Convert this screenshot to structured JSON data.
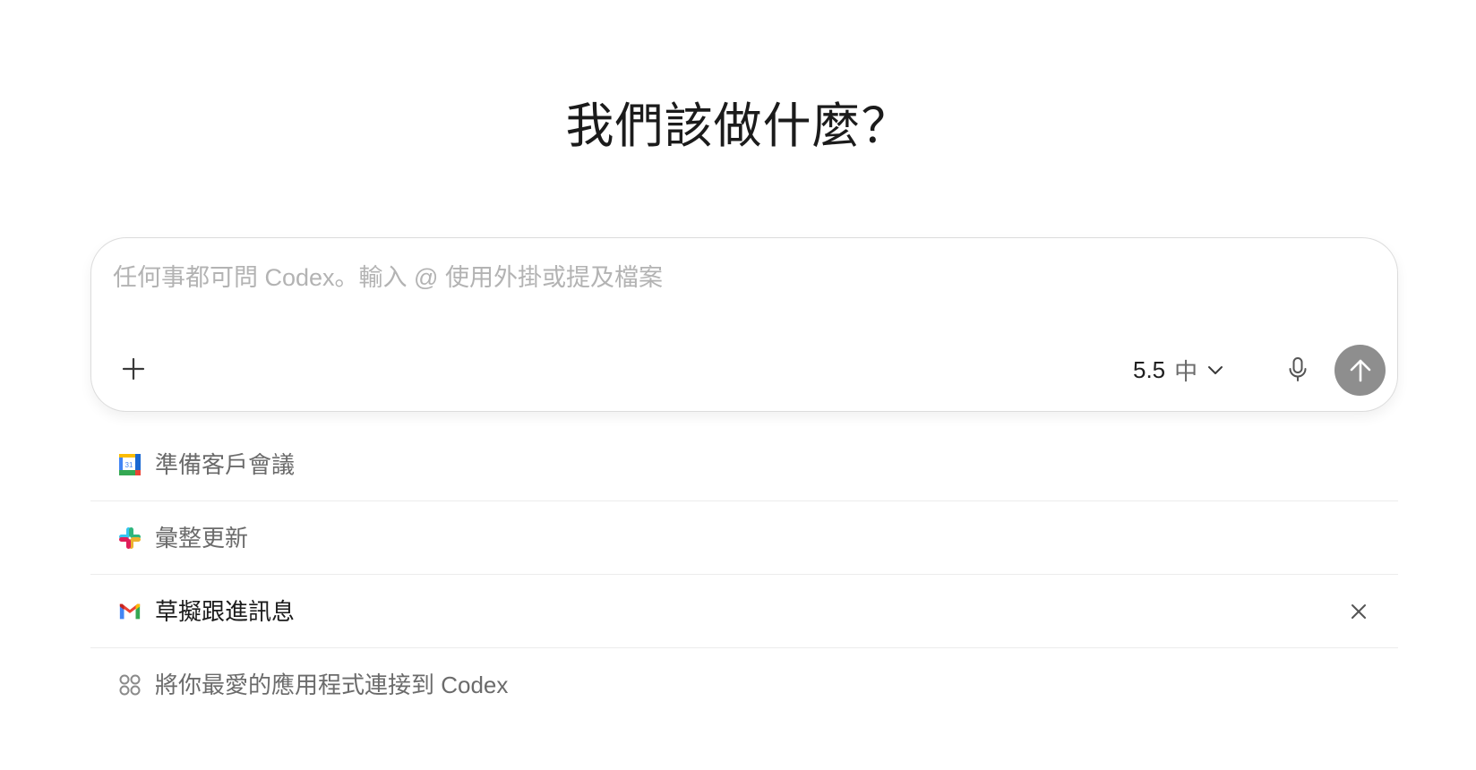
{
  "heading": "我們該做什麼？",
  "composer": {
    "placeholder": "任何事都可問 Codex。輸入 @ 使用外掛或提及檔案",
    "value": "",
    "add_icon": "plus-icon",
    "model": {
      "version": "5.5",
      "effort": "中",
      "icon": "chevron-down-icon"
    },
    "mic_icon": "microphone-icon",
    "send_icon": "arrow-up-icon",
    "send_color": "#8e8e8e"
  },
  "suggestions": [
    {
      "label": "準備客戶會議",
      "icon": "google-calendar-icon"
    },
    {
      "label": "彙整更新",
      "icon": "slack-icon"
    },
    {
      "label": "草擬跟進訊息",
      "icon": "gmail-icon",
      "dismiss_icon": "close-icon"
    },
    {
      "label": "將你最愛的應用程式連接到 Codex",
      "icon": "apps-grid-icon"
    }
  ]
}
